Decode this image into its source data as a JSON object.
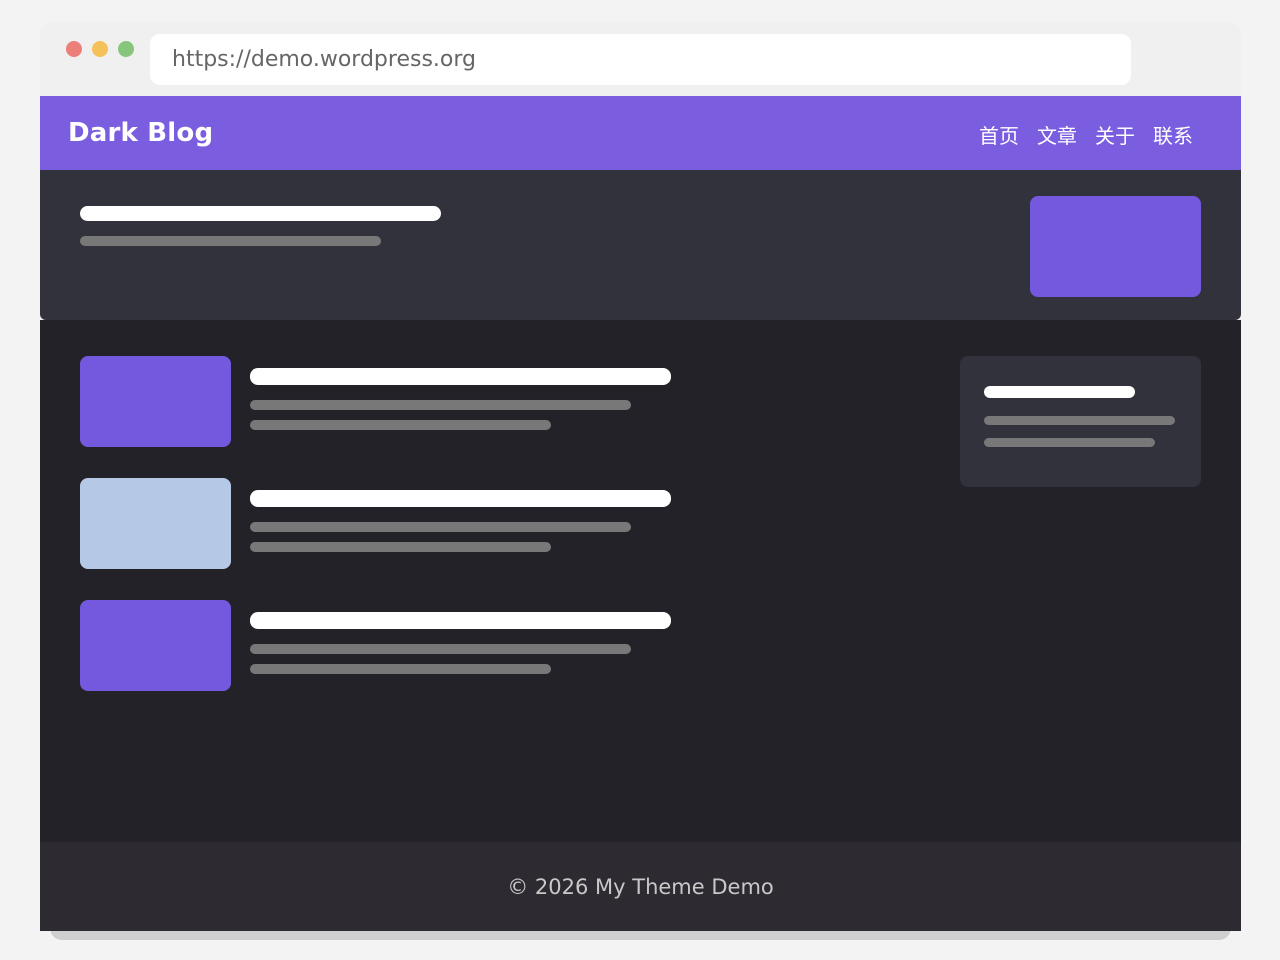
{
  "browser": {
    "url": "https://demo.wordpress.org"
  },
  "header": {
    "site_title": "Dark Blog",
    "nav": [
      "首页",
      "文章",
      "关于",
      "联系"
    ]
  },
  "footer": {
    "copyright": "© 2026 My Theme Demo"
  },
  "posts": [
    {
      "thumbnail_color": "#7459de"
    },
    {
      "thumbnail_color": "#b5c9e6"
    },
    {
      "thumbnail_color": "#7459de"
    }
  ],
  "colors": {
    "accent": "#7b5ddf",
    "hero_background": "#32323c",
    "main_background": "#232228",
    "footer_background": "#2d2b31"
  }
}
